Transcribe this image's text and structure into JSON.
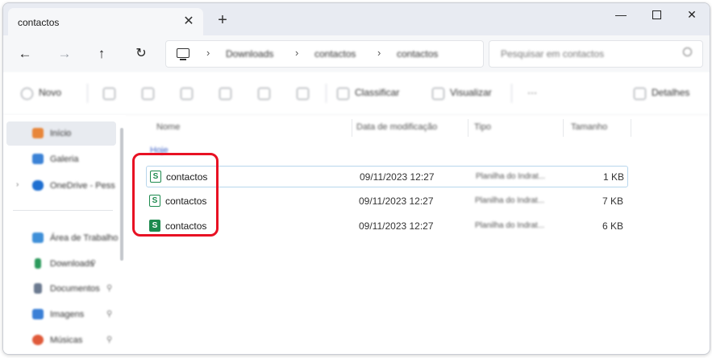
{
  "window": {
    "tab_title": "contactos",
    "tab_close": "✕",
    "new_tab": "+",
    "minimize": "—",
    "close": "✕"
  },
  "navigation": {
    "back": "←",
    "forward": "→",
    "up": "↑",
    "refresh": "↻"
  },
  "address": {
    "separator": "›",
    "crumbs": [
      "Downloads",
      "contactos",
      "contactos"
    ]
  },
  "search": {
    "placeholder": "Pesquisar em contactos"
  },
  "commands": {
    "new": "Novo",
    "sort": "Classificar",
    "view": "Visualizar",
    "more": "···",
    "details": "Detalhes"
  },
  "sidebar": {
    "items": [
      {
        "label": "Início",
        "icon": "home-icon",
        "color": "#e8863a"
      },
      {
        "label": "Galeria",
        "icon": "gallery-icon",
        "color": "#3b82d6"
      },
      {
        "label": "OneDrive - Pess",
        "icon": "cloud-icon",
        "color": "#1f6fd1"
      },
      {
        "label": "Área de Trabalho",
        "icon": "desktop-icon",
        "color": "#3f8fd8"
      },
      {
        "label": "Downloads",
        "icon": "download-icon",
        "color": "#2c9a5c"
      },
      {
        "label": "Documentos",
        "icon": "documents-icon",
        "color": "#6b7a90"
      },
      {
        "label": "Imagens",
        "icon": "pictures-icon",
        "color": "#3b7fd6"
      },
      {
        "label": "Músicas",
        "icon": "music-icon",
        "color": "#e05a3a"
      }
    ],
    "pin": "⚲",
    "expand": "›"
  },
  "filelist": {
    "columns": {
      "name": "Nome",
      "modified": "Data de modificação",
      "type": "Tipo",
      "size": "Tamanho"
    },
    "group": "Hoje",
    "rows": [
      {
        "name": "contactos",
        "modified": "09/11/2023 12:27",
        "type": "Planilha do Indrat...",
        "size": "1 KB",
        "icon_letter": "S"
      },
      {
        "name": "contactos",
        "modified": "09/11/2023 12:27",
        "type": "Planilha do Indrat...",
        "size": "7 KB",
        "icon_letter": "S"
      },
      {
        "name": "contactos",
        "modified": "09/11/2023 12:27",
        "type": "Planilha do Indrat...",
        "size": "6 KB",
        "icon_letter": "S"
      }
    ]
  }
}
